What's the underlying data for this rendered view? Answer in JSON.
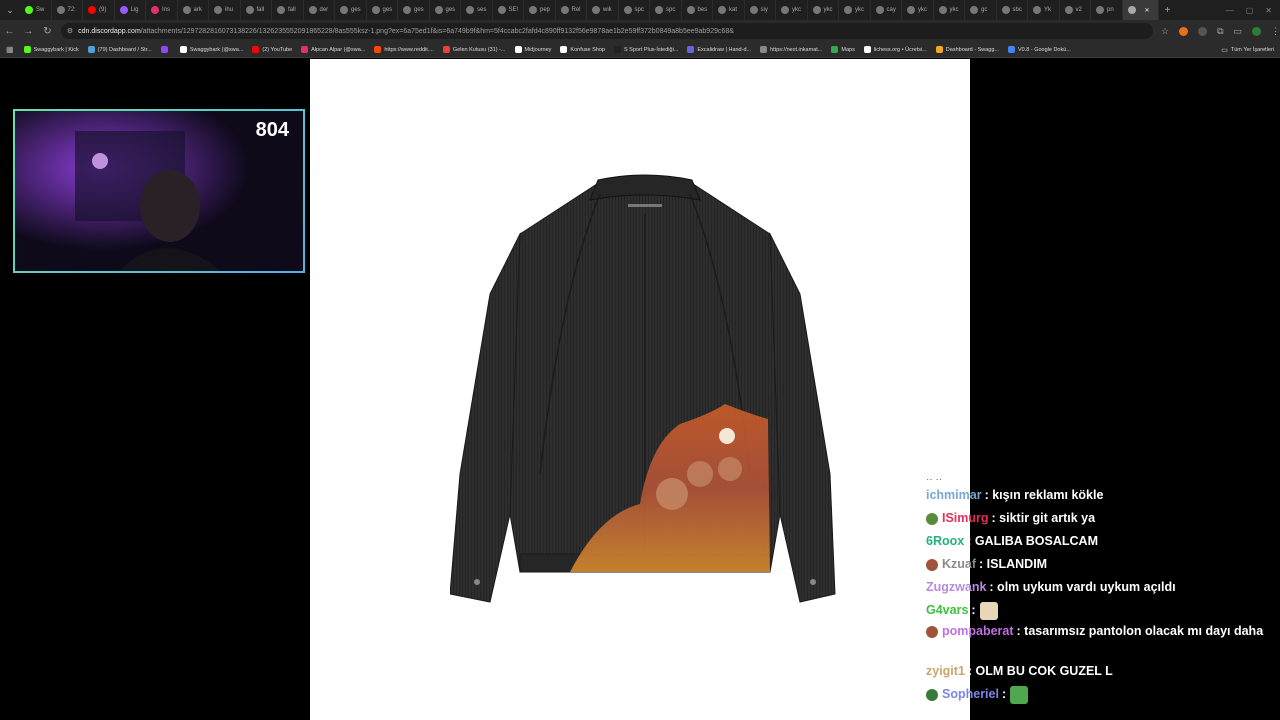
{
  "browser": {
    "tabs": [
      {
        "label": "Sw",
        "color": "#53fc18"
      },
      {
        "label": "72:",
        "color": "#777"
      },
      {
        "label": "(9)",
        "color": "#ff0000"
      },
      {
        "label": "Lig",
        "color": "#9b59ff"
      },
      {
        "label": "Ins",
        "color": "#e1306c"
      },
      {
        "label": "ark",
        "color": "#777"
      },
      {
        "label": "ihu",
        "color": "#777"
      },
      {
        "label": "fall",
        "color": "#777"
      },
      {
        "label": "fall",
        "color": "#777"
      },
      {
        "label": "der",
        "color": "#777"
      },
      {
        "label": "ges",
        "color": "#777"
      },
      {
        "label": "ges",
        "color": "#777"
      },
      {
        "label": "ges",
        "color": "#777"
      },
      {
        "label": "ges",
        "color": "#777"
      },
      {
        "label": "ses",
        "color": "#777"
      },
      {
        "label": "SE!",
        "color": "#777"
      },
      {
        "label": "pep",
        "color": "#777"
      },
      {
        "label": "Rel",
        "color": "#777"
      },
      {
        "label": "wik",
        "color": "#777"
      },
      {
        "label": "spc",
        "color": "#777"
      },
      {
        "label": "spc",
        "color": "#777"
      },
      {
        "label": "bes",
        "color": "#777"
      },
      {
        "label": "kat",
        "color": "#777"
      },
      {
        "label": "siy",
        "color": "#777"
      },
      {
        "label": "ykc",
        "color": "#777"
      },
      {
        "label": "ykc",
        "color": "#777"
      },
      {
        "label": "ykc",
        "color": "#777"
      },
      {
        "label": "cay",
        "color": "#777"
      },
      {
        "label": "ykc",
        "color": "#777"
      },
      {
        "label": "ykc",
        "color": "#777"
      },
      {
        "label": "gc",
        "color": "#777"
      },
      {
        "label": "sbc",
        "color": "#777"
      },
      {
        "label": "Yk",
        "color": "#777"
      },
      {
        "label": "v2",
        "color": "#777"
      },
      {
        "label": "pn",
        "color": "#777"
      }
    ],
    "active_tab_close": "✕",
    "new_tab": "+",
    "url_host": "cdn.discordapp.com",
    "url_path": "/attachments/1297282816073138226/1326235552091865228/8as555ksz-1.png?ex=6a75ed1f&is=6a749b9f&hm=5f4ccabc2fafd4c890ff9132f56e9878ae1b2e59ff372b0849a8b5ee9ab929c68&",
    "bookmarks": [
      {
        "label": "Swaggybark | Kick",
        "color": "#53fc18"
      },
      {
        "label": "(79) Dashboard / Str...",
        "color": "#4fa0d8"
      },
      {
        "label": "",
        "color": "#9146ff"
      },
      {
        "label": "Swaggybark (@swa...",
        "color": "#ffffff"
      },
      {
        "label": "(2) YouTube",
        "color": "#ff0000"
      },
      {
        "label": "Alpcan Alpar (@swa...",
        "color": "#e1306c"
      },
      {
        "label": "https://www.reddit....",
        "color": "#ff4500"
      },
      {
        "label": "Gelen Kutusu (31) -...",
        "color": "#ea4335"
      },
      {
        "label": "Midjourney",
        "color": "#ffffff"
      },
      {
        "label": "Konfuse Shop",
        "color": "#ffffff"
      },
      {
        "label": "S Sport Plus-İstediği...",
        "color": "#222222"
      },
      {
        "label": "Excalidraw | Hand-d...",
        "color": "#6965db"
      },
      {
        "label": "https://next.inkamat...",
        "color": "#888888"
      },
      {
        "label": "Maps",
        "color": "#34a853"
      },
      {
        "label": "lichess.org • Ücretsi...",
        "color": "#ffffff"
      },
      {
        "label": "Dashboard - Swagg...",
        "color": "#f5a623"
      },
      {
        "label": "V0.8 - Google Dokü...",
        "color": "#4285f4"
      }
    ],
    "all_bookmarks": "Tüm Yer İşaretleri"
  },
  "webcam": {
    "count": "804"
  },
  "chat": {
    "messages": [
      {
        "user": "ichmimar",
        "user_color": "#7aa7d6",
        "text": ": kışın reklamı kökle",
        "badge": null,
        "emote": null
      },
      {
        "user": "ISimurg",
        "user_color": "#e0315b",
        "text": ": siktir git artık ya",
        "badge": "#5a8a3c",
        "emote": null
      },
      {
        "user": "6Roox",
        "user_color": "#22b37a",
        "text": ": GALIBA BOSALCAM",
        "badge": null,
        "emote": null
      },
      {
        "user": "Kzuaf",
        "user_color": "#8a8a8a",
        "text": ": ISLANDIM",
        "badge": "#a0523a",
        "emote": null
      },
      {
        "user": "Zugzwank",
        "user_color": "#b68be0",
        "text": ": olm uykum vardı uykum açıldı",
        "badge": null,
        "emote": null
      },
      {
        "user": "G4vars",
        "user_color": "#3fbf3f",
        "text": ":",
        "badge": null,
        "emote": "#e8d6b8"
      },
      {
        "user": "pompaberat",
        "user_color": "#c070e0",
        "text": ": tasarımsız pantolon olacak mı dayı daha sade",
        "badge": "#a0523a",
        "emote": null
      },
      {
        "user": "zyigit1",
        "user_color": "#c9a66b",
        "text": ": OLM BU COK GUZEL L",
        "badge": null,
        "emote": null
      },
      {
        "user": "Sopheriel",
        "user_color": "#7a86e8",
        "text": ":",
        "badge": "#3a7a3a",
        "emote": "#4fa84f"
      }
    ]
  }
}
